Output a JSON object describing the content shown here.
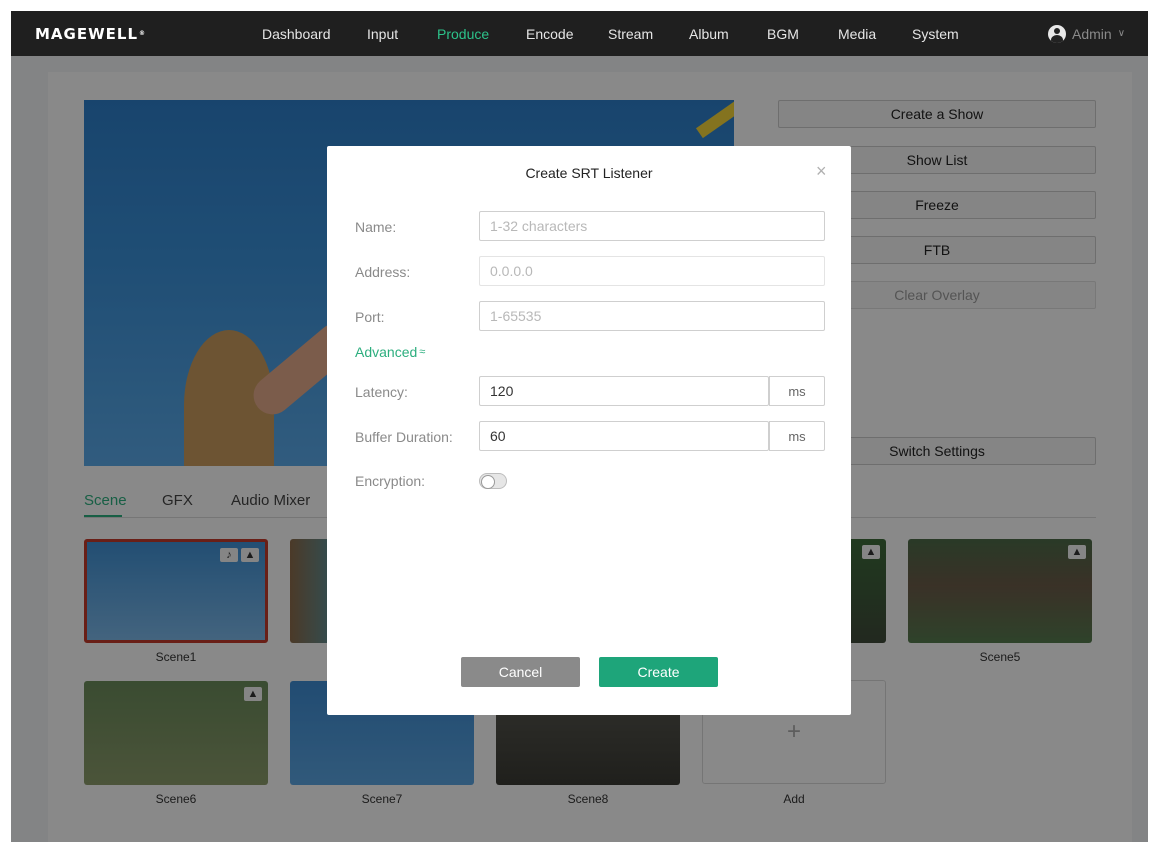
{
  "header": {
    "logo": "MAGEWELL",
    "nav": [
      {
        "label": "Dashboard",
        "active": false
      },
      {
        "label": "Input",
        "active": false
      },
      {
        "label": "Produce",
        "active": true
      },
      {
        "label": "Encode",
        "active": false
      },
      {
        "label": "Stream",
        "active": false
      },
      {
        "label": "Album",
        "active": false
      },
      {
        "label": "BGM",
        "active": false
      },
      {
        "label": "Media",
        "active": false
      },
      {
        "label": "System",
        "active": false
      }
    ],
    "user": "Admin"
  },
  "side_buttons": {
    "create_show": "Create a Show",
    "show_list": "Show List",
    "freeze": "Freeze",
    "ftb": "FTB",
    "clear_overlay": "Clear Overlay",
    "switch_settings": "Switch Settings"
  },
  "tabs": [
    "Scene",
    "GFX",
    "Audio Mixer"
  ],
  "scenes": [
    {
      "label": "Scene1"
    },
    {
      "label": "Scene5"
    },
    {
      "label": "Scene6"
    },
    {
      "label": "Scene7"
    },
    {
      "label": "Scene8"
    }
  ],
  "add_label": "Add",
  "add_icon": "+",
  "modal": {
    "title": "Create SRT Listener",
    "close_icon": "×",
    "fields": {
      "name_label": "Name:",
      "name_placeholder": "1-32 characters",
      "address_label": "Address:",
      "address_placeholder": "0.0.0.0",
      "port_label": "Port:",
      "port_placeholder": "1-65535",
      "advanced": "Advanced",
      "latency_label": "Latency:",
      "latency_value": "120",
      "latency_unit": "ms",
      "buffer_label": "Buffer Duration:",
      "buffer_value": "60",
      "buffer_unit": "ms",
      "encryption_label": "Encryption:",
      "encryption_on": false
    },
    "cancel": "Cancel",
    "create": "Create"
  },
  "colors": {
    "accent": "#2cae7e",
    "topbar": "#1f1f1f",
    "selected_border": "#c0392b"
  }
}
